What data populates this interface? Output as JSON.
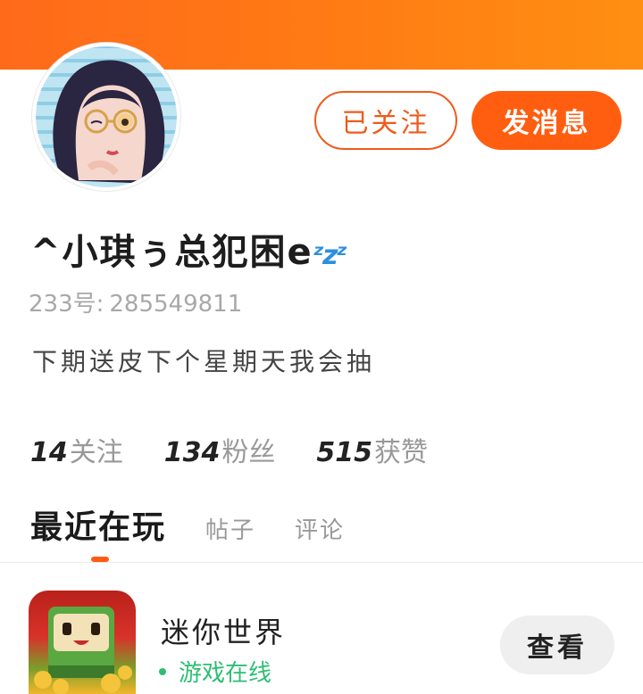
{
  "profile": {
    "username": "^小琪ぅ总犯困e",
    "zzz_emoji": "ᶻzᶻ",
    "id_label": "233号:",
    "id_value": "285549811",
    "bio": "下期送皮下个星期天我会抽",
    "actions": {
      "follow_label": "已关注",
      "message_label": "发消息"
    }
  },
  "stats": [
    {
      "value": "14",
      "label": "关注"
    },
    {
      "value": "134",
      "label": "粉丝"
    },
    {
      "value": "515",
      "label": "获赞"
    }
  ],
  "tabs": [
    {
      "label": "最近在玩",
      "active": true
    },
    {
      "label": "帖子",
      "active": false
    },
    {
      "label": "评论",
      "active": false
    }
  ],
  "recent_game": {
    "name": "迷你世界",
    "status": "游戏在线",
    "view_label": "查看"
  },
  "colors": {
    "brand_orange": "#ff5e10",
    "online_green": "#2dbf74"
  }
}
